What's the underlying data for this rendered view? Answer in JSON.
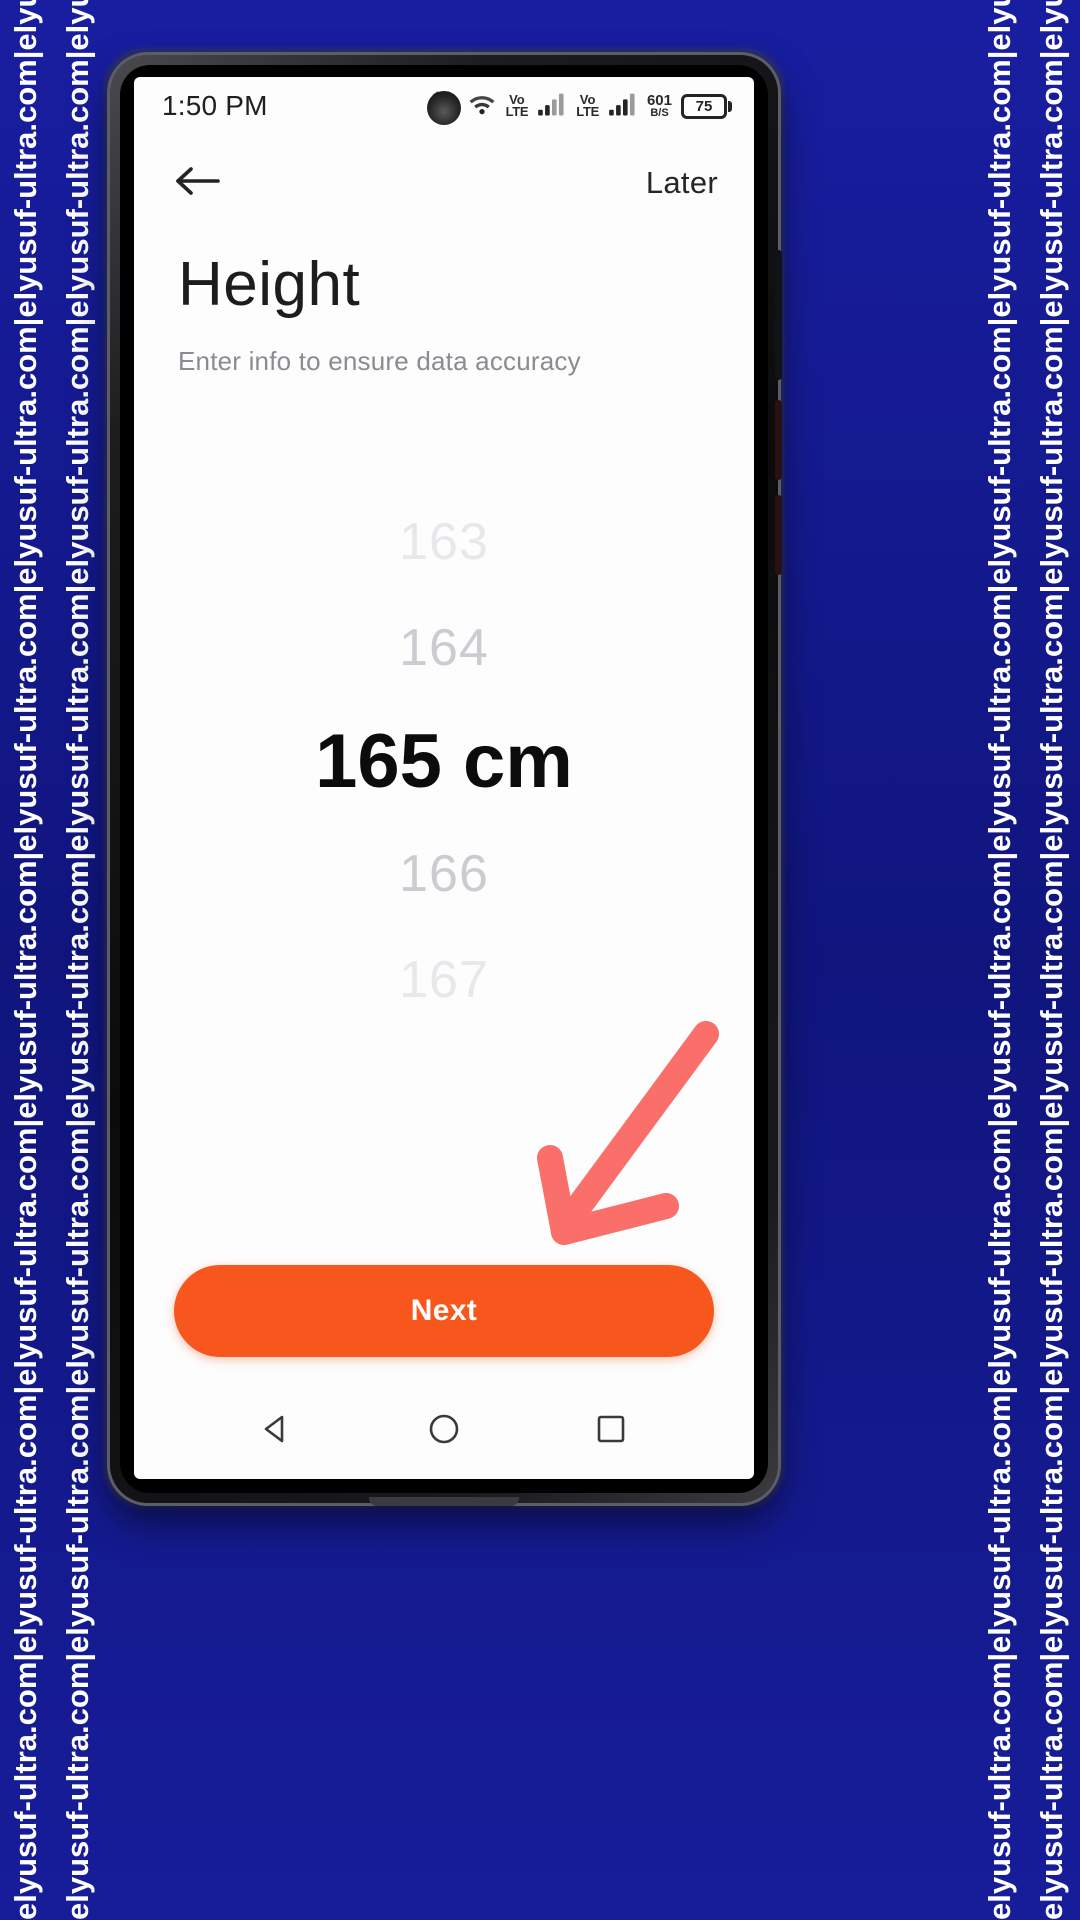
{
  "watermark": {
    "text": "elyusuf-ultra.com|",
    "repeat": 9,
    "color": "#ffffff",
    "background": "#151a8e"
  },
  "phone": {
    "statusbar": {
      "time": "1:50 PM",
      "icons": [
        "punch-hole-camera-icon",
        "alarm-icon",
        "wifi-icon",
        "volte-sim1-icon",
        "signal-sim1-icon",
        "volte-sim2-icon",
        "signal-sim2-icon"
      ],
      "volte_top": "Vo",
      "volte_bottom": "LTE",
      "network_speed": "601",
      "network_speed_unit": "B/S",
      "battery_level": "75"
    },
    "header": {
      "back_icon": "arrow-left-icon",
      "later_label": "Later"
    },
    "content": {
      "title": "Height",
      "subtitle": "Enter info to ensure data accuracy"
    },
    "picker": {
      "name": "height-picker",
      "unit": "cm",
      "selected_value": "165",
      "selected_display": "165 cm",
      "options": [
        {
          "value": "163",
          "state": "far"
        },
        {
          "value": "164",
          "state": "near"
        },
        {
          "value": "165 cm",
          "state": "selected"
        },
        {
          "value": "166",
          "state": "near"
        },
        {
          "value": "167",
          "state": "far"
        }
      ]
    },
    "cta": {
      "label": "Next",
      "color": "#f7571d",
      "text_color": "#ffffff"
    },
    "navbar": {
      "items": [
        {
          "name": "back-triangle-icon"
        },
        {
          "name": "home-circle-icon"
        },
        {
          "name": "recents-square-icon"
        }
      ]
    }
  },
  "annotation": {
    "name": "red-arrow-pointing-to-next-button",
    "color": "#fb6f6a"
  }
}
